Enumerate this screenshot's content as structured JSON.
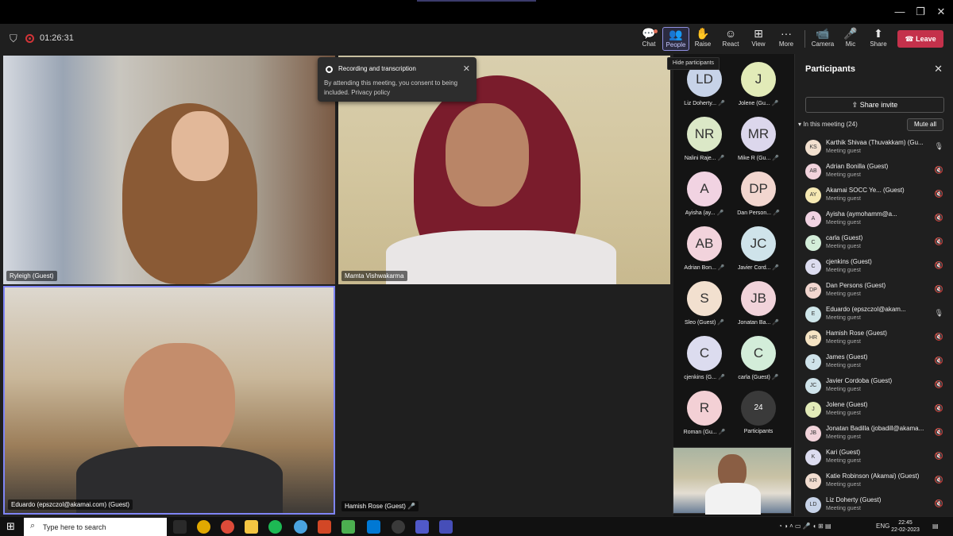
{
  "window": {
    "minimize": "—",
    "restore": "❐",
    "close": "✕"
  },
  "meeting": {
    "timer": "01:26:31",
    "toolbar": [
      {
        "key": "chat",
        "label": "Chat",
        "icon": "💬"
      },
      {
        "key": "people",
        "label": "People",
        "icon": "👥"
      },
      {
        "key": "raise",
        "label": "Raise",
        "icon": "✋"
      },
      {
        "key": "react",
        "label": "React",
        "icon": "☺"
      },
      {
        "key": "view",
        "label": "View",
        "icon": "⊞"
      },
      {
        "key": "more",
        "label": "More",
        "icon": "···"
      },
      {
        "key": "camera",
        "label": "Camera",
        "icon": "📹"
      },
      {
        "key": "mic",
        "label": "Mic",
        "icon": "🎤"
      },
      {
        "key": "share",
        "label": "Share",
        "icon": "⬆"
      }
    ],
    "leave_label": "Leave",
    "leave_icon": "☎",
    "tooltip": "Hide participants"
  },
  "notification": {
    "title": "Recording and transcription",
    "body": "By attending this meeting, you consent to being included. Privacy policy",
    "close": "✕"
  },
  "tiles": [
    {
      "name": "Ryleigh (Guest)"
    },
    {
      "name": "Mamta Vishwakarma"
    },
    {
      "name": "Eduardo (epszczol@akamai.com) (Guest)"
    },
    {
      "name": "Hamish Rose (Guest)"
    }
  ],
  "grid": [
    {
      "initials": "LD",
      "name": "Liz Doherty...",
      "color": "#c7d3e8"
    },
    {
      "initials": "J",
      "name": "Jolene (Gu...",
      "color": "#e2ebb8"
    },
    {
      "initials": "NR",
      "name": "Nalini Raje...",
      "color": "#dbe8c7"
    },
    {
      "initials": "MR",
      "name": "Mike R (Gu...",
      "color": "#dcd7ec"
    },
    {
      "initials": "A",
      "name": "Ayisha (ay...",
      "color": "#f1d3e2"
    },
    {
      "initials": "DP",
      "name": "Dan Person...",
      "color": "#f2d6cf"
    },
    {
      "initials": "AB",
      "name": "Adrian Bon...",
      "color": "#f2d3dc"
    },
    {
      "initials": "JC",
      "name": "Javier Cord...",
      "color": "#cfe3ea"
    },
    {
      "initials": "S",
      "name": "Sleo (Guest)",
      "color": "#f2e0cf"
    },
    {
      "initials": "JB",
      "name": "Jonatan Ba...",
      "color": "#f1d3da"
    },
    {
      "initials": "C",
      "name": "cjenkins (G...",
      "color": "#dcdcef"
    },
    {
      "initials": "C",
      "name": "carla (Guest)",
      "color": "#d3edd9"
    },
    {
      "initials": "R",
      "name": "Roman (Gu...",
      "color": "#f3d0d5"
    },
    {
      "initials": "24",
      "name": "Participants",
      "color": "#3a3a3a"
    }
  ],
  "panel": {
    "title": "Participants",
    "close": "✕",
    "invite": "Share invite",
    "in_meeting": "In this meeting (24)",
    "mute_all": "Mute all",
    "people": [
      {
        "initials": "KS",
        "name": "Karthik Shivaa (Thuvakkam) (Gu...",
        "role": "Meeting guest",
        "color": "#f2e0cf",
        "mic": "on"
      },
      {
        "initials": "AB",
        "name": "Adrian Bonilla (Guest)",
        "role": "Meeting guest",
        "color": "#f2d3dc",
        "mic": "off"
      },
      {
        "initials": "AY",
        "name": "Akamai SOCC Ye... (Guest)",
        "role": "Meeting guest",
        "color": "#f6e9b3",
        "mic": "off"
      },
      {
        "initials": "A",
        "name": "Ayisha (aymohamm@a...",
        "role": "Meeting guest",
        "color": "#f1d3e2",
        "mic": "off"
      },
      {
        "initials": "C",
        "name": "carla (Guest)",
        "role": "Meeting guest",
        "color": "#d3edd9",
        "mic": "off"
      },
      {
        "initials": "C",
        "name": "cjenkins (Guest)",
        "role": "Meeting guest",
        "color": "#dcdcef",
        "mic": "off"
      },
      {
        "initials": "DP",
        "name": "Dan Persons (Guest)",
        "role": "Meeting guest",
        "color": "#f2d6cf",
        "mic": "off"
      },
      {
        "initials": "E",
        "name": "Eduardo (epszczol@akam...",
        "role": "Meeting guest",
        "color": "#cfe6ea",
        "mic": "on"
      },
      {
        "initials": "HR",
        "name": "Hamish Rose (Guest)",
        "role": "Meeting guest",
        "color": "#f6e4c4",
        "mic": "off"
      },
      {
        "initials": "J",
        "name": "James (Guest)",
        "role": "Meeting guest",
        "color": "#cfe3ea",
        "mic": "off"
      },
      {
        "initials": "JC",
        "name": "Javier Cordoba (Guest)",
        "role": "Meeting guest",
        "color": "#cfe3ea",
        "mic": "off"
      },
      {
        "initials": "J",
        "name": "Jolene (Guest)",
        "role": "Meeting guest",
        "color": "#e2ebb8",
        "mic": "off"
      },
      {
        "initials": "JB",
        "name": "Jonatan Badilla (jobadill@akama...",
        "role": "Meeting guest",
        "color": "#f1d3da",
        "mic": "off"
      },
      {
        "initials": "K",
        "name": "Kari (Guest)",
        "role": "Meeting guest",
        "color": "#dcdcef",
        "mic": "off"
      },
      {
        "initials": "KR",
        "name": "Katie Robinson (Akamai) (Guest)",
        "role": "Meeting guest",
        "color": "#f2ddd0",
        "mic": "off"
      },
      {
        "initials": "LD",
        "name": "Liz Doherty (Guest)",
        "role": "Meeting guest",
        "color": "#c7d3e8",
        "mic": "off"
      }
    ]
  },
  "taskbar": {
    "search_placeholder": "Type here to search",
    "language": "ENG",
    "time": "22:45",
    "date": "22-02-2023"
  }
}
